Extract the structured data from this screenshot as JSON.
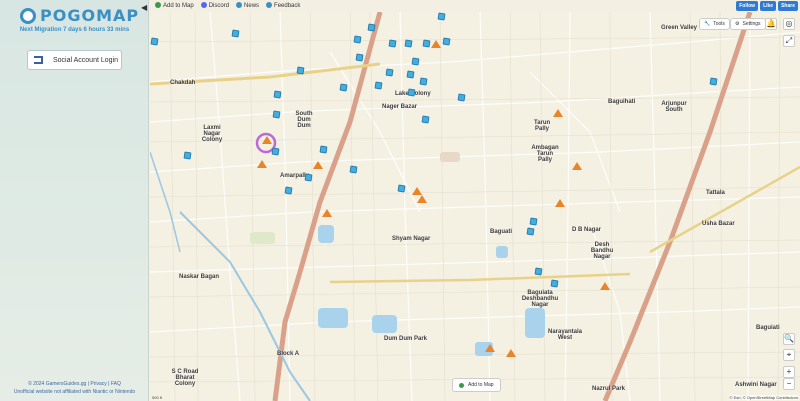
{
  "sidebar": {
    "logo_text": "POGOMAP",
    "migration": "Next Migration 7 days 6 hours 33 mins",
    "login_label": "Social Account Login",
    "footer_line1": "© 2024 GamersGuides.gg  |  Privacy  |  FAQ",
    "footer_line2": "Unofficial website not affiliated with Niantic or Nintendo"
  },
  "topbar": {
    "items": [
      "Add to Map",
      "Discord",
      "News",
      "Feedback"
    ],
    "social": [
      "Follow",
      "Like",
      "Share"
    ],
    "colors": {
      "add": "#3a9a4a",
      "discord": "#5865f2",
      "news": "#3a8fc3",
      "feedback": "#3a8fc3"
    }
  },
  "map": {
    "tools_label": "Tools",
    "settings_label": "Settings",
    "add_to_map_label": "Add to Map",
    "attribution": "© Esri, © OpenStreetMap Contributors",
    "scale": "500 ft",
    "labels": [
      {
        "text": "Green Valley"
      },
      {
        "text": "Chakdah"
      },
      {
        "text": "Lake Colony"
      },
      {
        "text": "Nager Bazar"
      },
      {
        "text": "Baguihati"
      },
      {
        "text": "Arjunpur South"
      },
      {
        "text": "Laxmi Nagar Colony"
      },
      {
        "text": "South Dum Dum"
      },
      {
        "text": "Tarun Pally"
      },
      {
        "text": "Ambagan Tarun Pally"
      },
      {
        "text": "Amarpally"
      },
      {
        "text": "Tattala"
      },
      {
        "text": "Usha Bazar"
      },
      {
        "text": "D B Nagar"
      },
      {
        "text": "Shyam Nagar"
      },
      {
        "text": "Baguati"
      },
      {
        "text": "Desh Bandhu Nagar"
      },
      {
        "text": "Naskar Bagan"
      },
      {
        "text": "Baguiata Deshbandhu Nagar"
      },
      {
        "text": "Baguiati"
      },
      {
        "text": "Narayantala West"
      },
      {
        "text": "Dum Dum Park"
      },
      {
        "text": "Block A"
      },
      {
        "text": "S C Road Bharat Colony"
      },
      {
        "text": "Nazrul Park"
      },
      {
        "text": "Ashwini Nagar"
      }
    ]
  }
}
